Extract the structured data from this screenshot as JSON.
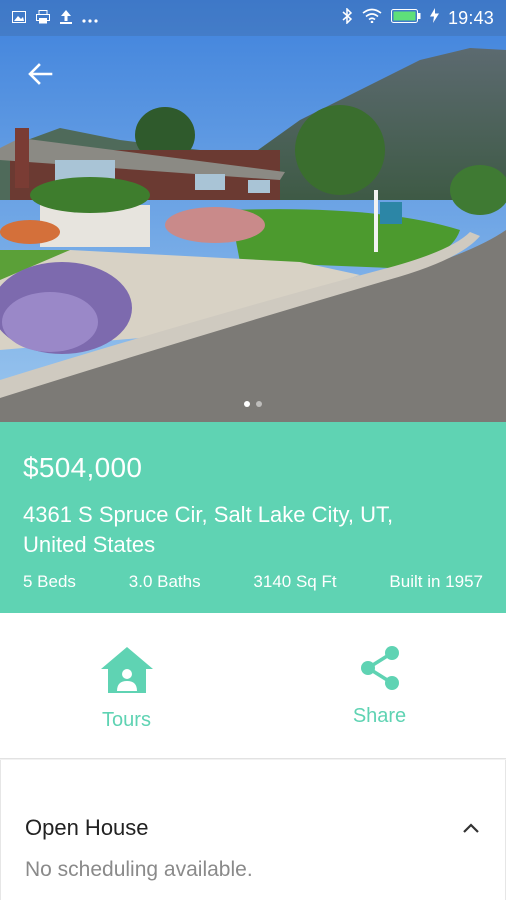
{
  "theme": {
    "accent": "#5fd3b3"
  },
  "status_bar": {
    "left_icons": [
      "gallery-icon",
      "print-icon",
      "upload-icon",
      "more-dots-icon"
    ],
    "right_icons": [
      "bluetooth-icon",
      "wifi-icon",
      "battery-icon",
      "charging-icon"
    ],
    "time": "19:43"
  },
  "hero": {
    "back_icon": "back-arrow-icon",
    "photo_count": 2,
    "active_photo": 1
  },
  "listing": {
    "price": "$504,000",
    "address_line1": "4361 S Spruce Cir, Salt Lake City, UT,",
    "address_line2": "United States",
    "beds": "5 Beds",
    "baths": "3.0 Baths",
    "sqft": "3140 Sq Ft",
    "built": "Built in 1957"
  },
  "actions": {
    "tours_label": "Tours",
    "tours_icon": "house-person-icon",
    "share_label": "Share",
    "share_icon": "share-icon"
  },
  "open_house": {
    "title": "Open House",
    "collapse_icon": "chevron-up-icon",
    "message": "No scheduling available."
  }
}
